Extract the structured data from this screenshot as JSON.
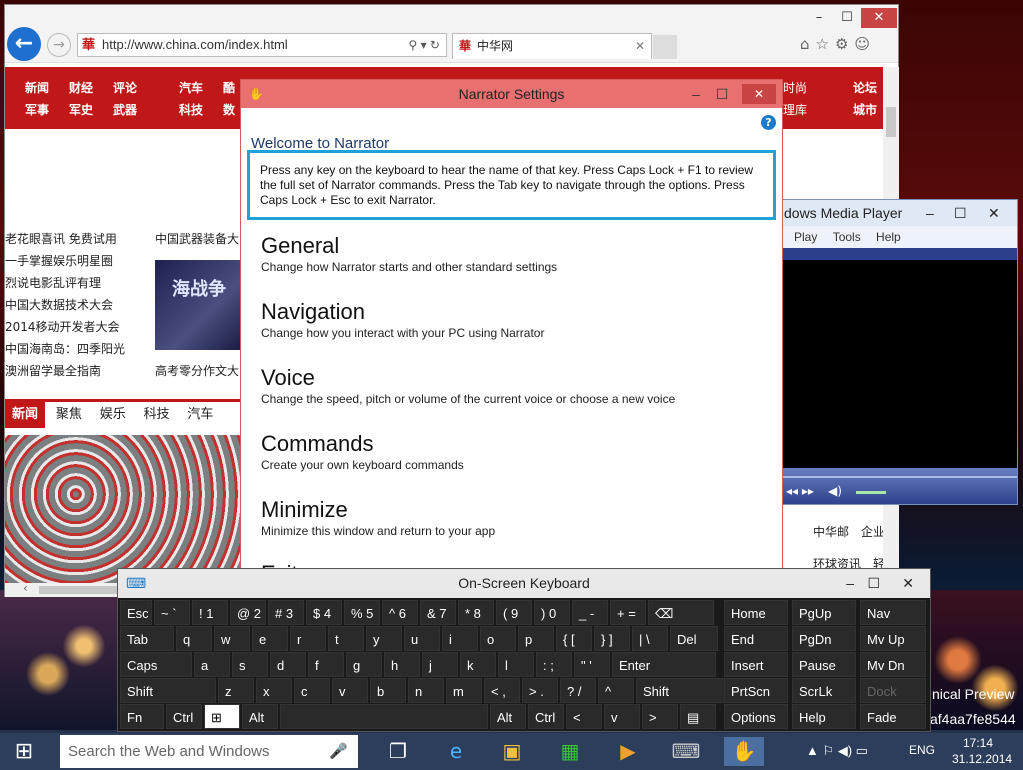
{
  "ie": {
    "url": "http://www.china.com/index.html",
    "tab_title": "中华网",
    "fav_glyph": "華",
    "nav_row1": [
      "新闻",
      "财经",
      "评论",
      "汽车",
      "酷"
    ],
    "nav_row2": [
      "军事",
      "军史",
      "武器",
      "科技",
      "数"
    ],
    "nav_right1": [
      "时尚",
      "论坛"
    ],
    "nav_right2": [
      "理库",
      "城市"
    ],
    "links": [
      "老花眼喜讯 免费试用",
      "一手掌握娱乐明星圈",
      "烈说电影乱评有理",
      "中国大数据技术大会",
      "2014移动开发者大会",
      "中国海南岛：四季阳光",
      "澳洲留学最全指南"
    ],
    "links2": [
      "中国武器装备大",
      "高考零分作文大"
    ],
    "banner_text": "海战争",
    "tabs": [
      "新闻",
      "聚焦",
      "娱乐",
      "科技",
      "汽车"
    ],
    "right_links": [
      [
        "中华邮",
        "企业"
      ],
      [
        "环球资讯",
        "轻"
      ]
    ]
  },
  "narrator": {
    "title": "Narrator Settings",
    "welcome": "Welcome to Narrator",
    "intro": "Press any key on the keyboard to hear the name of that key.  Press Caps Lock + F1 to review the full set of Narrator commands.  Press the Tab key to navigate through the options.  Press Caps Lock + Esc to exit Narrator.",
    "sections": [
      {
        "title": "General",
        "desc": "Change how Narrator starts and other standard settings"
      },
      {
        "title": "Navigation",
        "desc": "Change how you interact with your PC using Narrator"
      },
      {
        "title": "Voice",
        "desc": "Change the speed, pitch or volume of the current voice or choose a new voice"
      },
      {
        "title": "Commands",
        "desc": "Create your own keyboard commands"
      },
      {
        "title": "Minimize",
        "desc": "Minimize this window and return to your app"
      },
      {
        "title": "Exit",
        "desc": ""
      }
    ]
  },
  "wmp": {
    "title": "dows Media Player",
    "menu": [
      "Play",
      "Tools",
      "Help"
    ]
  },
  "osk": {
    "title": "On-Screen Keyboard",
    "rows": [
      [
        "Esc",
        "~ `",
        "! 1",
        "@ 2",
        "# 3",
        "$ 4",
        "% 5",
        "^ 6",
        "& 7",
        "* 8",
        "( 9",
        ") 0",
        "_ -",
        "+ =",
        "⌫"
      ],
      [
        "Tab",
        "q",
        "w",
        "e",
        "r",
        "t",
        "y",
        "u",
        "i",
        "o",
        "p",
        "{ [",
        "} ]",
        "| \\",
        "Del"
      ],
      [
        "Caps",
        "a",
        "s",
        "d",
        "f",
        "g",
        "h",
        "j",
        "k",
        "l",
        ": ;",
        "\" '",
        "Enter"
      ],
      [
        "Shift",
        "z",
        "x",
        "c",
        "v",
        "b",
        "n",
        "m",
        "< ,",
        "> .",
        "? /",
        "^",
        "Shift"
      ],
      [
        "Fn",
        "Ctrl",
        "⊞",
        "Alt",
        "",
        "Alt",
        "Ctrl",
        "<",
        "v",
        ">",
        "▤"
      ]
    ],
    "nav_rows": [
      [
        "Home",
        "PgUp",
        "Nav"
      ],
      [
        "End",
        "PgDn",
        "Mv Up"
      ],
      [
        "Insert",
        "Pause",
        "Mv Dn"
      ],
      [
        "PrtScn",
        "ScrLk",
        "Dock"
      ],
      [
        "Options",
        "Help",
        "Fade"
      ]
    ]
  },
  "desktop": {
    "watermark1": "nical Preview",
    "watermark2": "af4aa7fe8544"
  },
  "taskbar": {
    "search_placeholder": "Search the Web and Windows",
    "language": "ENG",
    "time": "17:14",
    "date": "31.12.2014"
  }
}
